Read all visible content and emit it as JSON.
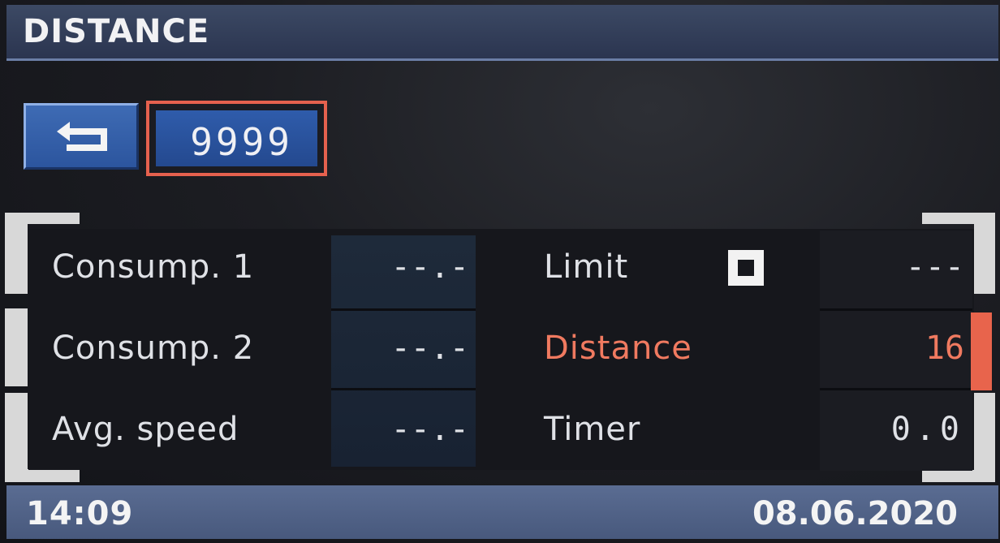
{
  "header": {
    "title": "DISTANCE"
  },
  "controls": {
    "back_icon": "return-arrow-icon",
    "value": "9999"
  },
  "rows": [
    {
      "label": "Consump. 1",
      "value": "--.-"
    },
    {
      "label": "Consump. 2",
      "value": "--.-"
    },
    {
      "label": "Avg. speed",
      "value": "--.-"
    }
  ],
  "settings": [
    {
      "label": "Limit",
      "value": "---",
      "checkbox": "unchecked"
    },
    {
      "label": "Distance",
      "value": "16"
    },
    {
      "label": "Timer",
      "value": "0.0"
    }
  ],
  "footer": {
    "time": "14:09",
    "date": "08.06.2020"
  },
  "colors": {
    "accent": "#e5614e",
    "button_blue": "#2f5cab",
    "header_bar": "#2b3550",
    "footer_bar": "#48597d",
    "active_text": "#f07a60"
  }
}
